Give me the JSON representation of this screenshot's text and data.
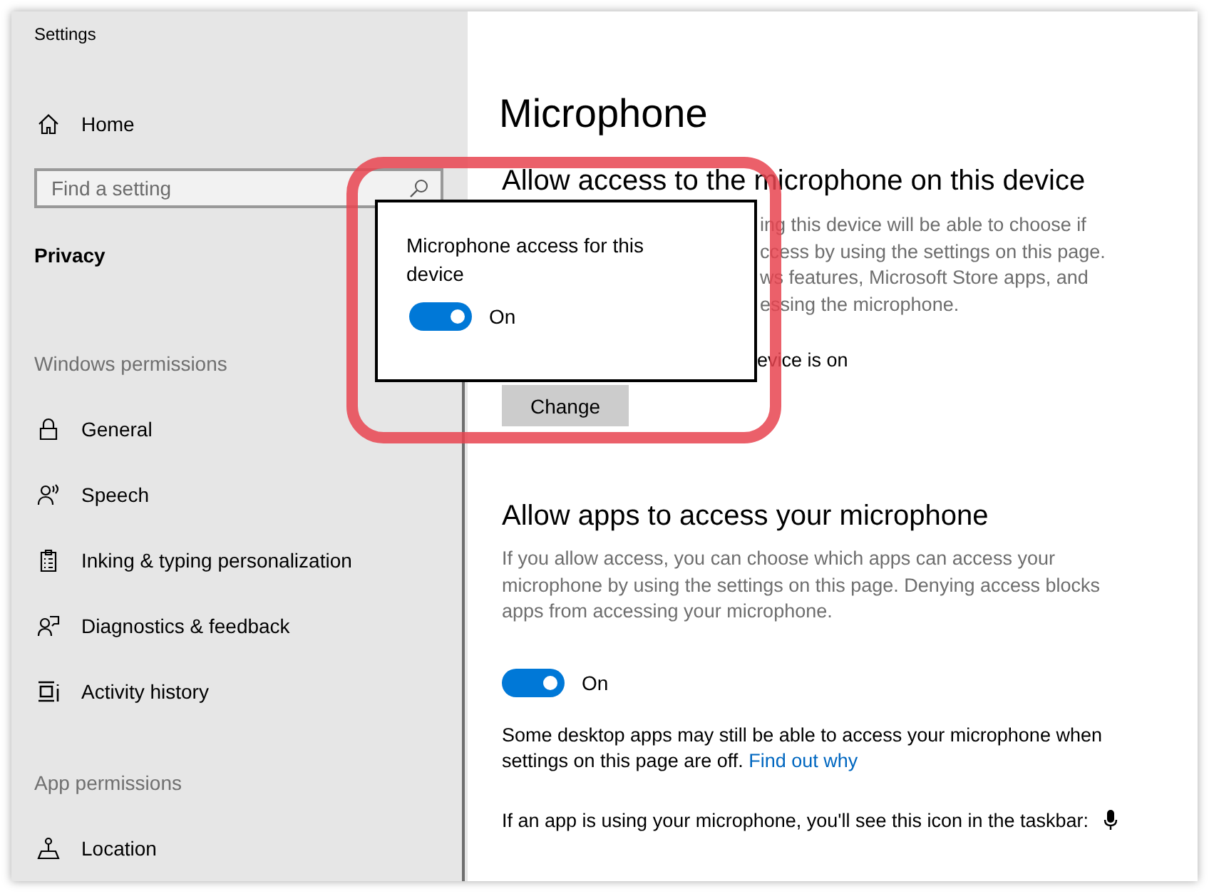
{
  "window": {
    "title": "Settings"
  },
  "sidebar": {
    "home": "Home",
    "search": {
      "placeholder": "Find a setting"
    },
    "section": "Privacy",
    "groups": [
      {
        "heading": "Windows permissions",
        "items": [
          {
            "label": "General"
          },
          {
            "label": "Speech"
          },
          {
            "label": "Inking & typing personalization"
          },
          {
            "label": "Diagnostics & feedback"
          },
          {
            "label": "Activity history"
          }
        ]
      },
      {
        "heading": "App permissions",
        "items": [
          {
            "label": "Location"
          }
        ]
      }
    ]
  },
  "main": {
    "title": "Microphone",
    "device_section": {
      "heading": "Allow access to the microphone on this device",
      "description_fragments": [
        "ing this device will be able to choose if",
        "ccess by using the settings on this page.",
        "ws features, Microsoft Store apps, and",
        "essing the microphone."
      ],
      "status_fragment": "evice is on",
      "button": "Change"
    },
    "apps_section": {
      "heading": "Allow apps to access your microphone",
      "description": "If you allow access, you can choose which apps can access your microphone by using the settings on this page. Denying access blocks apps from accessing your microphone.",
      "toggle": {
        "on": true,
        "label": "On"
      },
      "note": "Some desktop apps may still be able to access your microphone when settings on this page are off.",
      "note_link": "Find out why",
      "taskbar_note": "If an app is using your microphone, you'll see this icon in the taskbar:"
    }
  },
  "popup": {
    "title": "Microphone access for this device",
    "toggle": {
      "on": true,
      "label": "On"
    }
  }
}
